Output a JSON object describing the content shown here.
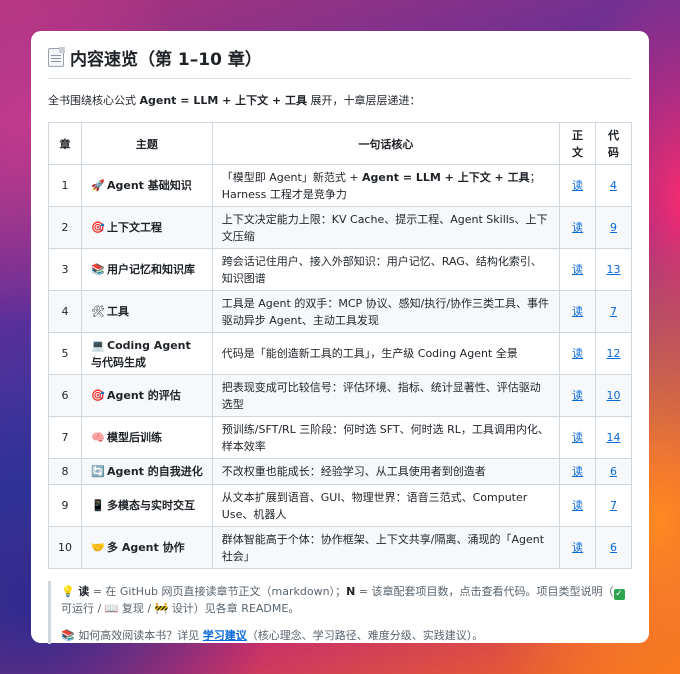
{
  "header": {
    "title": "内容速览（第 1–10 章）",
    "icon": "page-icon"
  },
  "intro": {
    "prefix": "全书围绕核心公式 ",
    "formula": "Agent = LLM + 上下文 + 工具",
    "suffix": " 展开，十章层层递进："
  },
  "table": {
    "headers": [
      "章",
      "主题",
      "一句话核心",
      "正文",
      "代码"
    ],
    "rows": [
      {
        "num": "1",
        "emoji": "🚀",
        "topic": "Agent 基础知识",
        "core_a": "「模型即 Agent」新范式 + ",
        "core_b": "Agent = LLM + 上下文 + 工具",
        "core_c": "；Harness 工程才是竞争力",
        "link": "读",
        "code": "4"
      },
      {
        "num": "2",
        "emoji": "🎯",
        "topic": "上下文工程",
        "core_a": "上下文决定能力上限：KV Cache、提示工程、Agent Skills、上下文压缩",
        "core_b": "",
        "core_c": "",
        "link": "读",
        "code": "9"
      },
      {
        "num": "3",
        "emoji": "📚",
        "topic": "用户记忆和知识库",
        "core_a": "跨会话记住用户、接入外部知识：用户记忆、RAG、结构化索引、知识图谱",
        "core_b": "",
        "core_c": "",
        "link": "读",
        "code": "13"
      },
      {
        "num": "4",
        "emoji": "🛠",
        "topic": "工具",
        "core_a": "工具是 Agent 的双手：MCP 协议、感知/执行/协作三类工具、事件驱动异步 Agent、主动工具发现",
        "core_b": "",
        "core_c": "",
        "link": "读",
        "code": "7"
      },
      {
        "num": "5",
        "emoji": "💻",
        "topic": "Coding Agent 与代码生成",
        "core_a": "代码是「能创造新工具的工具」，生产级 Coding Agent 全景",
        "core_b": "",
        "core_c": "",
        "link": "读",
        "code": "12"
      },
      {
        "num": "6",
        "emoji": "🎯",
        "topic": "Agent 的评估",
        "core_a": "把表现变成可比较信号：评估环境、指标、统计显著性、评估驱动选型",
        "core_b": "",
        "core_c": "",
        "link": "读",
        "code": "10"
      },
      {
        "num": "7",
        "emoji": "🧠",
        "topic": "模型后训练",
        "core_a": "预训练/SFT/RL 三阶段：何时选 SFT、何时选 RL，工具调用内化、样本效率",
        "core_b": "",
        "core_c": "",
        "link": "读",
        "code": "14"
      },
      {
        "num": "8",
        "emoji": "🔄",
        "topic": "Agent 的自我进化",
        "core_a": "不改权重也能成长：经验学习、从工具使用者到创造者",
        "core_b": "",
        "core_c": "",
        "link": "读",
        "code": "6"
      },
      {
        "num": "9",
        "emoji": "📱",
        "topic": "多模态与实时交互",
        "core_a": "从文本扩展到语音、GUI、物理世界：语音三范式、Computer Use、机器人",
        "core_b": "",
        "core_c": "",
        "link": "读",
        "code": "7"
      },
      {
        "num": "10",
        "emoji": "🤝",
        "topic": "多 Agent 协作",
        "core_a": "群体智能高于个体：协作框架、上下文共享/隔离、涌现的「Agent 社会」",
        "core_b": "",
        "core_c": "",
        "link": "读",
        "code": "6"
      }
    ]
  },
  "note": {
    "bulb_icon": "💡",
    "read_term": "读",
    "read_desc": " = 在 GitHub 网页直接读章节正文（markdown）；",
    "n_term": "N",
    "n_desc": " = 该章配套项目数，点击查看代码。项目类型说明（",
    "check_icon": "✓",
    "type_a": "可运行 / ",
    "book_icon": "📖",
    "type_b": " 复现 / ",
    "build_icon": "🚧",
    "type_c": " 设计）见各章 README。",
    "books_icon": "📚",
    "howto_prefix": " 如何高效阅读本书？详见 ",
    "howto_link": "学习建议",
    "howto_suffix": "（核心理念、学习路径、难度分级、实践建议）。"
  }
}
